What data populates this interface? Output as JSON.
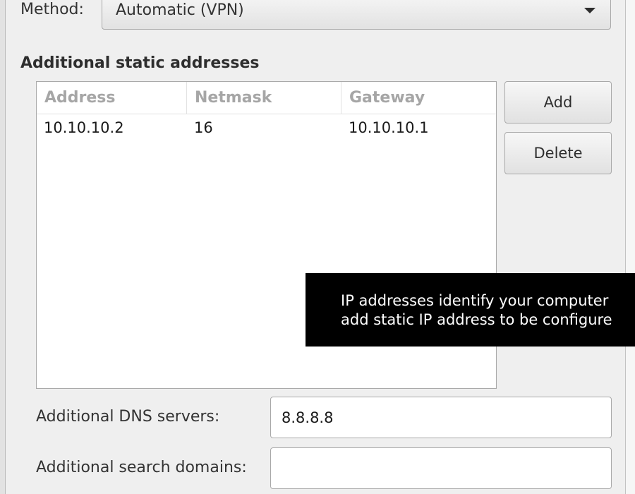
{
  "method": {
    "label": "Method:",
    "selected": "Automatic (VPN)"
  },
  "static_addresses": {
    "title": "Additional static addresses",
    "columns": [
      "Address",
      "Netmask",
      "Gateway"
    ],
    "rows": [
      [
        "10.10.10.2",
        "16",
        "10.10.10.1"
      ]
    ],
    "add_label": "Add",
    "delete_label": "Delete"
  },
  "tooltip": {
    "line1": "IP addresses identify your computer",
    "line2": "add static IP address to be configure"
  },
  "dns": {
    "label": "Additional DNS servers:",
    "value": "8.8.8.8"
  },
  "search_domains": {
    "label": "Additional search domains:",
    "value": ""
  }
}
